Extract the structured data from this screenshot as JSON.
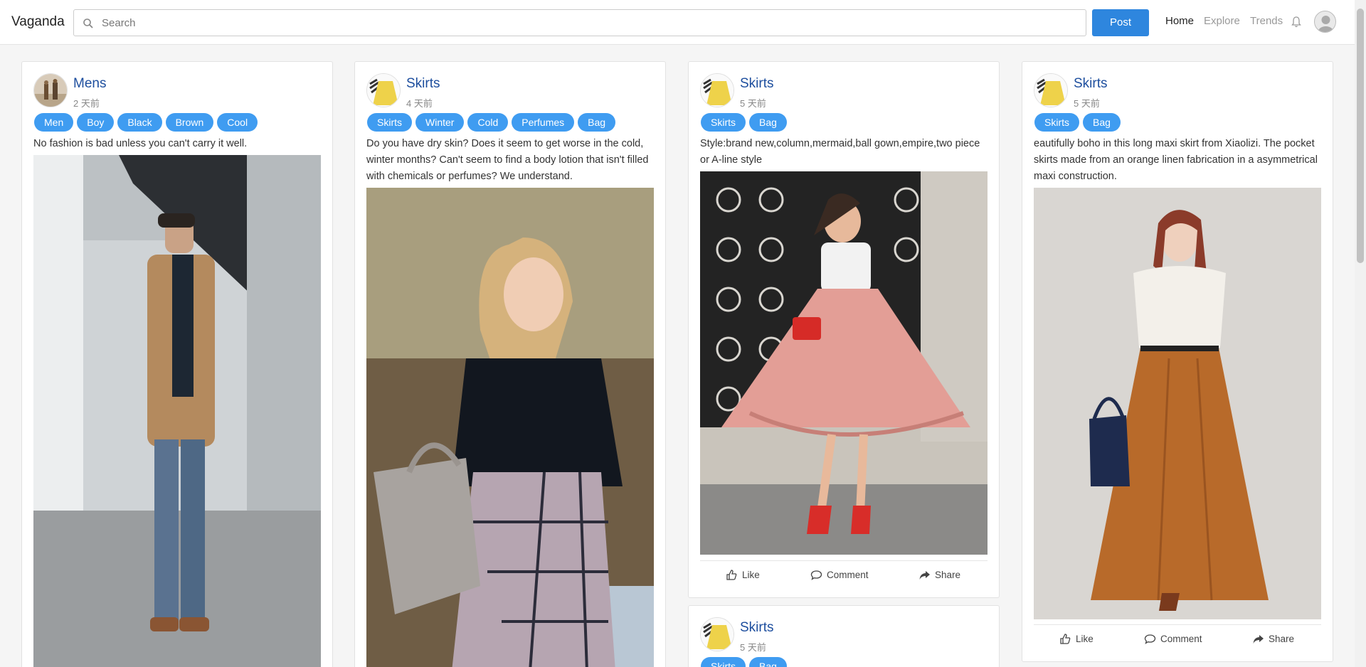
{
  "nav": {
    "brand": "Vaganda",
    "search_placeholder": "Search",
    "post_label": "Post",
    "links": [
      "Home",
      "Explore",
      "Trends"
    ],
    "icons": [
      "search-icon",
      "bell-icon",
      "user-avatar-icon"
    ]
  },
  "actions": {
    "like": "Like",
    "comment": "Comment",
    "share": "Share"
  },
  "cards": [
    {
      "name": "Mens",
      "time": "2 天前",
      "tags": [
        "Men",
        "Boy",
        "Black",
        "Brown",
        "Cool"
      ],
      "text": "No fashion is bad unless you can't carry it well."
    },
    {
      "name": "Skirts",
      "time": "4 天前",
      "tags": [
        "Skirts",
        "Winter",
        "Cold",
        "Perfumes",
        "Bag"
      ],
      "text": "Do you have dry skin? Does it seem to get worse in the cold, winter months? Can't seem to find a body lotion that isn't filled with chemicals or perfumes? We understand."
    },
    {
      "name": "Skirts",
      "time": "5 天前",
      "tags": [
        "Skirts",
        "Bag"
      ],
      "text": "Style:brand new,column,mermaid,ball gown,empire,two piece or A-line style"
    },
    {
      "name": "Skirts",
      "time": "5 天前",
      "tags": [
        "Skirts",
        "Bag"
      ],
      "text": "eautifully boho in this long maxi skirt from Xiaolizi. The pocket skirts made from an orange linen fabrication in a asymmetrical maxi construction."
    },
    {
      "name": "Skirts",
      "time": "5 天前",
      "tags": [
        "Skirts",
        "Bag"
      ],
      "text": ""
    }
  ]
}
